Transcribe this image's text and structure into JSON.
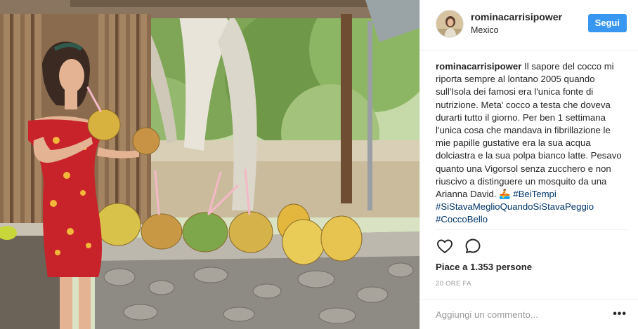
{
  "post": {
    "username": "rominacarrisipower",
    "location": "Mexico",
    "follow_label": "Segui",
    "caption": {
      "username": "rominacarrisipower",
      "text": " Il sapore del cocco mi riporta sempre al lontano 2005 quando sull'Isola dei famosi era l'unica fonte di nutrizione. Meta' cocco a testa che doveva durarti tutto il giorno. Per ben 1 settimana l'unica cosa che mandava in fibrillazione le mie papille gustative era la sua acqua dolciastra e la sua polpa bianco latte. Pesavo quanto una Vigorsol senza zucchero e non riuscivo a distinguere un mosquito da una Arianna David. 🚣 ",
      "hashtags": [
        "#BeiTempi",
        "#SiStavaMeglioQuandoSiStavaPeggio",
        "#CoccoBello"
      ]
    },
    "likes_text": "Piace a 1.353 persone",
    "timestamp": "20 ORE FA",
    "comment_placeholder": "Aggiungi un commento...",
    "more_icon": "more-dots-icon",
    "icons": [
      "heart-icon",
      "comment-icon"
    ],
    "colors": {
      "follow_button": "#3897f0",
      "hashtag": "#003569",
      "muted_text": "#999999",
      "divider": "#efefef"
    }
  }
}
